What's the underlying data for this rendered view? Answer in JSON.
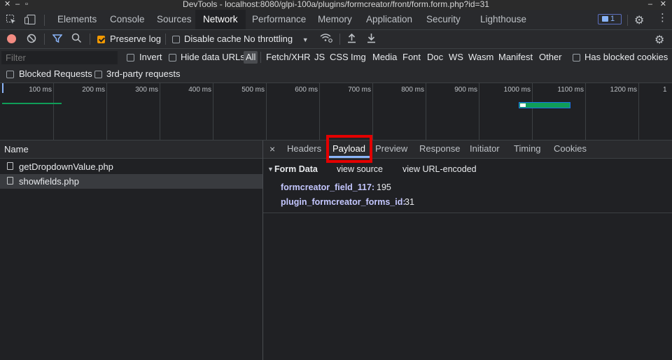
{
  "window": {
    "title": "DevTools - localhost:8080/glpi-100a/plugins/formcreator/front/form.form.php?id=31"
  },
  "panel_tabs": [
    "Elements",
    "Console",
    "Sources",
    "Network",
    "Performance",
    "Memory",
    "Application",
    "Security",
    "Lighthouse"
  ],
  "active_panel": "Network",
  "issues_badge": {
    "count": "1"
  },
  "toolbar": {
    "preserve_log": "Preserve log",
    "disable_cache": "Disable cache",
    "throttling": "No throttling"
  },
  "filter": {
    "placeholder": "Filter",
    "invert": "Invert",
    "hide_data_urls": "Hide data URLs",
    "types": [
      "All",
      "Fetch/XHR",
      "JS",
      "CSS",
      "Img",
      "Media",
      "Font",
      "Doc",
      "WS",
      "Wasm",
      "Manifest",
      "Other"
    ],
    "has_blocked_cookies": "Has blocked cookies",
    "blocked_requests": "Blocked Requests",
    "third_party": "3rd-party requests"
  },
  "timeline": {
    "ticks": [
      "100 ms",
      "200 ms",
      "300 ms",
      "400 ms",
      "500 ms",
      "600 ms",
      "700 ms",
      "800 ms",
      "900 ms",
      "1000 ms",
      "1100 ms",
      "1200 ms",
      "1"
    ]
  },
  "requests": {
    "header": "Name",
    "items": [
      "getDropdownValue.php",
      "showfields.php"
    ],
    "selected": "showfields.php"
  },
  "details": {
    "close": "×",
    "tabs": [
      "Headers",
      "Payload",
      "Preview",
      "Response",
      "Initiator",
      "Timing",
      "Cookies"
    ],
    "active_tab": "Payload",
    "section": "Form Data",
    "view_source": "view source",
    "view_url_encoded": "view URL-encoded",
    "form_data": [
      {
        "key": "formcreator_field_117:",
        "value": "195"
      },
      {
        "key": "plugin_formcreator_forms_id:",
        "value": "31"
      }
    ]
  },
  "colors": {
    "accent": "#8ab4f8",
    "highlight": "#e30000",
    "checkbox": "#f29900",
    "timing_bar": "#0f9d58"
  }
}
